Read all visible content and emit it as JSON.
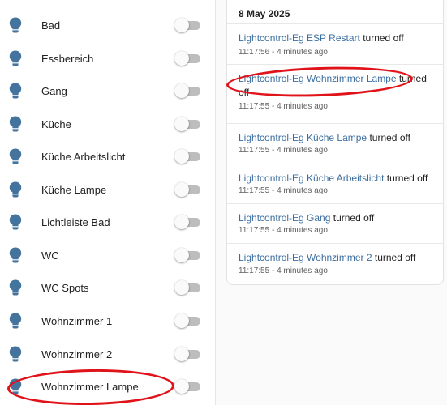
{
  "lights": [
    {
      "label": "Bad"
    },
    {
      "label": "Essbereich"
    },
    {
      "label": "Gang"
    },
    {
      "label": "Küche"
    },
    {
      "label": "Küche Arbeitslicht"
    },
    {
      "label": "Küche Lampe"
    },
    {
      "label": "Lichtleiste Bad"
    },
    {
      "label": "WC"
    },
    {
      "label": "WC Spots"
    },
    {
      "label": "Wohnzimmer 1"
    },
    {
      "label": "Wohnzimmer 2"
    },
    {
      "label": "Wohnzimmer Lampe"
    }
  ],
  "logbook": {
    "date": "8 May 2025",
    "entries": [
      {
        "entity": "Lightcontrol-Eg ESP Restart",
        "action": "turned off",
        "time": "11:17:56 - 4 minutes ago"
      },
      {
        "entity": "Lightcontrol-Eg Wohnzimmer Lampe",
        "action": "turned off",
        "time": "11:17:55 - 4 minutes ago"
      },
      {
        "entity": "Lightcontrol-Eg Küche Lampe",
        "action": "turned off",
        "time": "11:17:55 - 4 minutes ago"
      },
      {
        "entity": "Lightcontrol-Eg Küche Arbeitslicht",
        "action": "turned off",
        "time": "11:17:55 - 4 minutes ago"
      },
      {
        "entity": "Lightcontrol-Eg Gang",
        "action": "turned off",
        "time": "11:17:55 - 4 minutes ago"
      },
      {
        "entity": "Lightcontrol-Eg Wohnzimmer 2",
        "action": "turned off",
        "time": "11:17:55 - 4 minutes ago"
      }
    ]
  },
  "colors": {
    "bulb_icon": "#44739e",
    "entity_link": "#3b6ea0",
    "toggle_off_track": "#bdbdbd",
    "annotation": "#e0131b"
  },
  "icons": {
    "light": "lightbulb-icon"
  }
}
